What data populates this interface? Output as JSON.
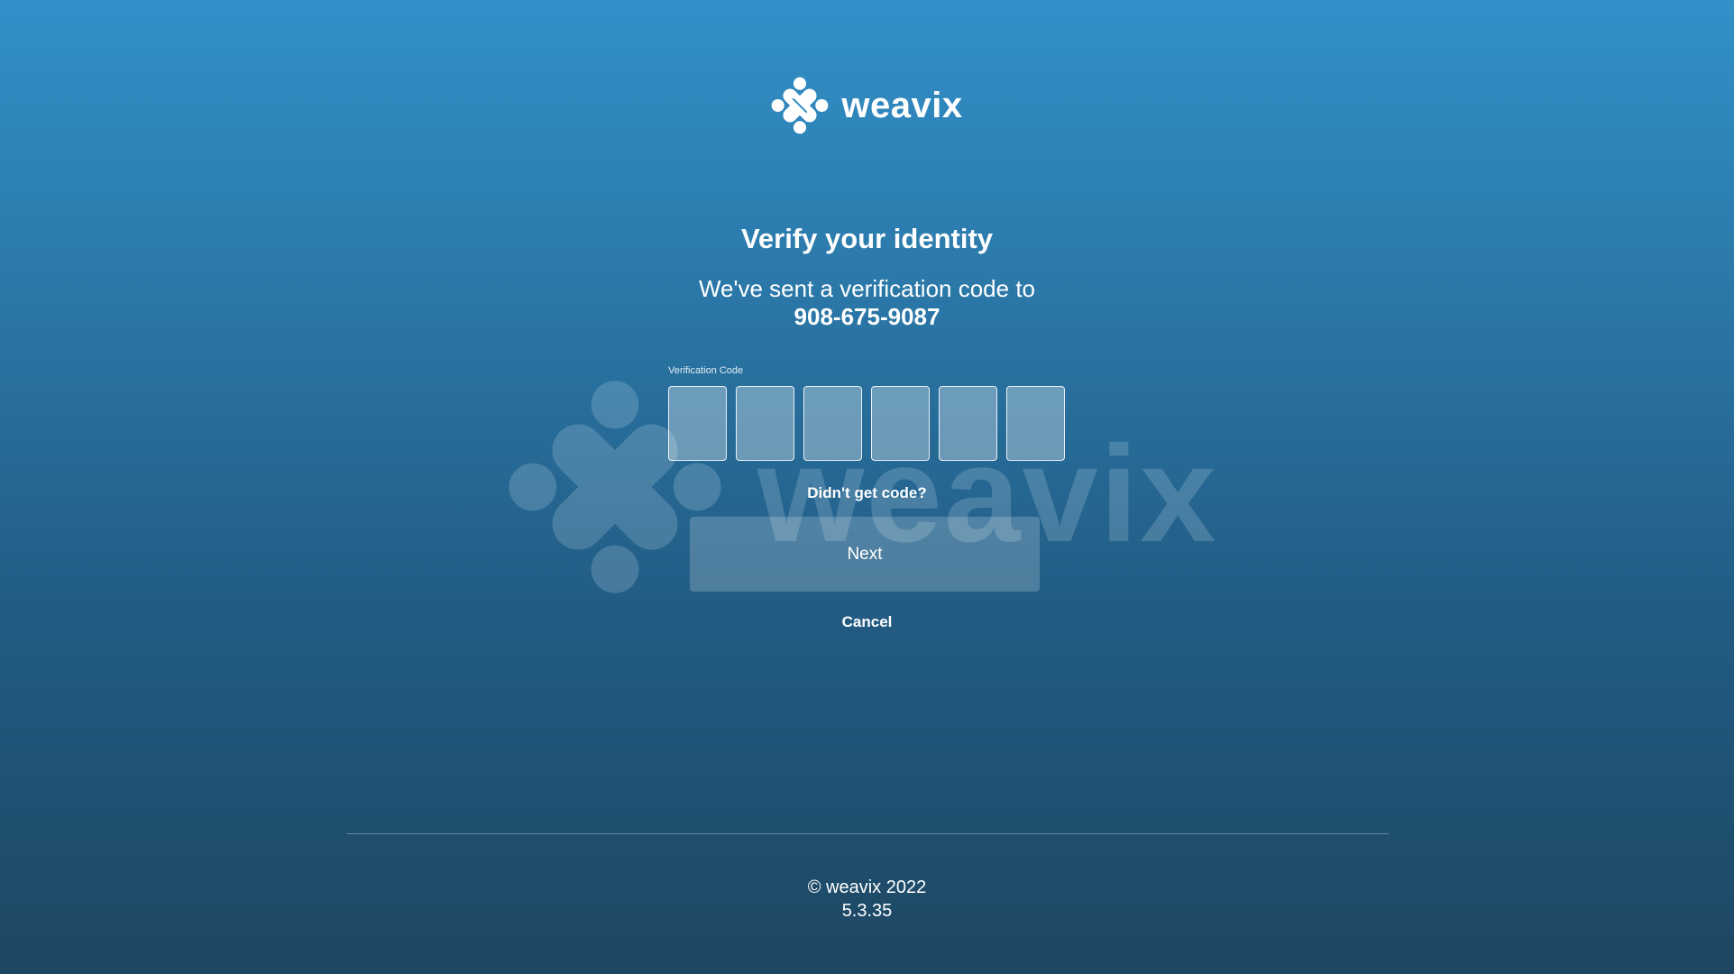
{
  "brand": {
    "name": "weavix",
    "logo_icon": "weavix-logo-icon",
    "watermark_icon": "weavix-watermark-icon"
  },
  "page": {
    "title": "Verify your identity",
    "subtitle": "We've sent a verification code to",
    "phone": "908-675-9087"
  },
  "form": {
    "code_label": "Verification Code",
    "code_digits": [
      "",
      "",
      "",
      "",
      "",
      ""
    ],
    "resend_label": "Didn't get code?",
    "next_label": "Next",
    "cancel_label": "Cancel"
  },
  "footer": {
    "copyright": "© weavix 2022",
    "version": "5.3.35"
  },
  "colors": {
    "background_top": "#3290c8",
    "background_bottom": "#1d4762",
    "text": "#ffffff"
  }
}
